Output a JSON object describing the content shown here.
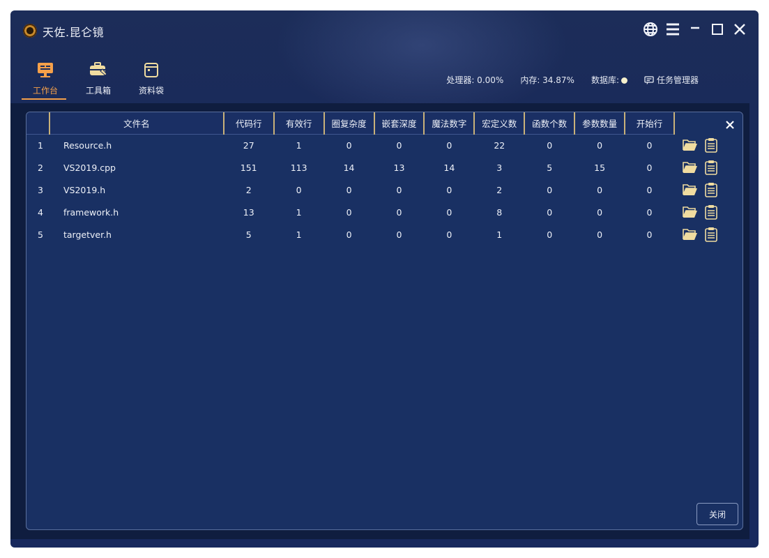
{
  "app": {
    "title": "天佐.昆仑镜"
  },
  "window_controls": [
    "globe-icon",
    "menu-icon",
    "minimize-icon",
    "maximize-icon",
    "close-icon"
  ],
  "nav": [
    {
      "label": "工作台",
      "icon": "workbench-icon",
      "active": true
    },
    {
      "label": "工具箱",
      "icon": "toolbox-icon",
      "active": false
    },
    {
      "label": "资料袋",
      "icon": "document-bag-icon",
      "active": false
    }
  ],
  "status": {
    "cpu": "处理器: 0.00%",
    "memory": "内存: 34.87%",
    "database": "数据库:",
    "task_manager": "任务管理器"
  },
  "table": {
    "headers": [
      "",
      "文件名",
      "代码行",
      "有效行",
      "圈复杂度",
      "嵌套深度",
      "魔法数字",
      "宏定义数",
      "函数个数",
      "参数数量",
      "开始行"
    ],
    "rows": [
      [
        "1",
        "Resource.h",
        "27",
        "1",
        "0",
        "0",
        "0",
        "22",
        "0",
        "0",
        "0"
      ],
      [
        "2",
        "VS2019.cpp",
        "151",
        "113",
        "14",
        "13",
        "14",
        "3",
        "5",
        "15",
        "0"
      ],
      [
        "3",
        "VS2019.h",
        "2",
        "0",
        "0",
        "0",
        "0",
        "2",
        "0",
        "0",
        "0"
      ],
      [
        "4",
        "framework.h",
        "13",
        "1",
        "0",
        "0",
        "0",
        "8",
        "0",
        "0",
        "0"
      ],
      [
        "5",
        "targetver.h",
        "5",
        "1",
        "0",
        "0",
        "0",
        "1",
        "0",
        "0",
        "0"
      ]
    ],
    "row_actions": [
      "open-folder-icon",
      "clipboard-icon"
    ]
  },
  "dialog": {
    "close_button": "关闭"
  },
  "colors": {
    "accent": "#f5a04a",
    "background": "#18295d",
    "header_divider": "#c9b27a",
    "folder_icon": "#f0dca0"
  }
}
